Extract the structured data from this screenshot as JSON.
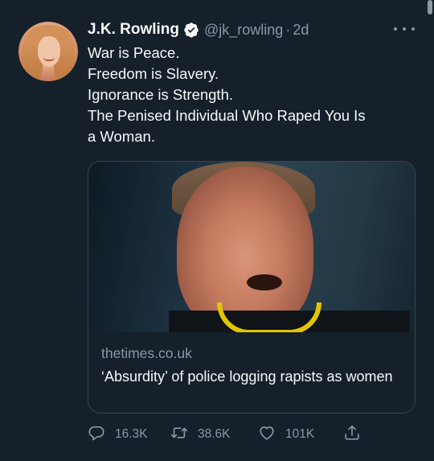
{
  "tweet": {
    "author_name": "J.K. Rowling",
    "handle": "@jk_rowling",
    "separator": "·",
    "time": "2d",
    "verified": true,
    "lines": [
      "War is Peace.",
      "Freedom is Slavery.",
      "Ignorance is Strength.",
      "The Penised Individual Who Raped You Is",
      "a Woman."
    ],
    "card": {
      "domain": "thetimes.co.uk",
      "title": "‘Absurdity’ of police logging rapists as women"
    },
    "actions": {
      "replies": "16.3K",
      "retweets": "38.6K",
      "likes": "101K"
    }
  },
  "colors": {
    "background": "#15202b",
    "text_primary": "#f7f9f9",
    "text_secondary": "#8b98a5",
    "border": "#38444d",
    "verified_badge": "#f7f9f9"
  },
  "icons": {
    "reply": "reply-icon",
    "retweet": "retweet-icon",
    "like": "like-icon",
    "share": "share-icon",
    "more": "more-icon",
    "verified": "verified-icon"
  }
}
